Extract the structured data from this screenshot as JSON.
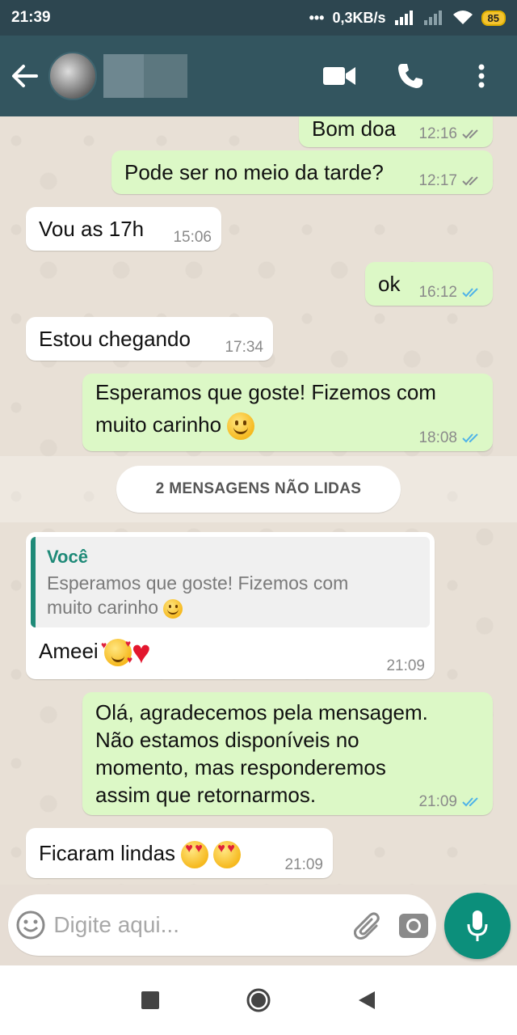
{
  "status_bar": {
    "time": "21:39",
    "network_speed": "0,3KB/s",
    "battery": "85",
    "icons": [
      "dots-icon",
      "signal-icon",
      "signal-icon",
      "wifi-icon",
      "battery-icon"
    ]
  },
  "header": {
    "contact_name": "",
    "icons": [
      "back-arrow-icon",
      "video-call-icon",
      "phone-icon",
      "more-vertical-icon"
    ]
  },
  "messages": [
    {
      "dir": "out",
      "text": "Bom doa",
      "time": "12:16",
      "status": "delivered"
    },
    {
      "dir": "out",
      "text": "Pode ser no meio da tarde?",
      "time": "12:17",
      "status": "delivered"
    },
    {
      "dir": "in",
      "text": "Vou as 17h",
      "time": "15:06"
    },
    {
      "dir": "out",
      "text": "ok",
      "time": "16:12",
      "status": "read"
    },
    {
      "dir": "in",
      "text": "Estou chegando",
      "time": "17:34"
    },
    {
      "dir": "out",
      "text_line1": "Esperamos que goste! Fizemos com",
      "text_line2": "muito carinho",
      "time": "18:08",
      "status": "read"
    },
    {
      "dir": "in",
      "reply_author": "Você",
      "reply_line1": "Esperamos que goste! Fizemos com",
      "reply_line2": "muito carinho",
      "text": "Ameei",
      "time": "21:09"
    },
    {
      "dir": "out",
      "lines": [
        "Olá, agradecemos pela mensagem.",
        "Não estamos disponíveis no",
        "momento, mas responderemos",
        "assim que retornarmos."
      ],
      "time": "21:09",
      "status": "read"
    },
    {
      "dir": "in",
      "text": "Ficaram lindas",
      "time": "21:09"
    }
  ],
  "unread_divider": "2 MENSAGENS NÃO LIDAS",
  "composer": {
    "placeholder": "Digite aqui...",
    "value": "",
    "icons": [
      "emoji-icon",
      "attach-icon",
      "camera-icon",
      "mic-icon"
    ]
  },
  "colors": {
    "header": "#33555f",
    "outgoing_bubble": "#dcf8c6",
    "incoming_bubble": "#ffffff",
    "accent": "#0c8f7b",
    "read_tick": "#4fb3e8"
  },
  "nav": [
    "recents-icon",
    "home-icon",
    "back-icon"
  ]
}
